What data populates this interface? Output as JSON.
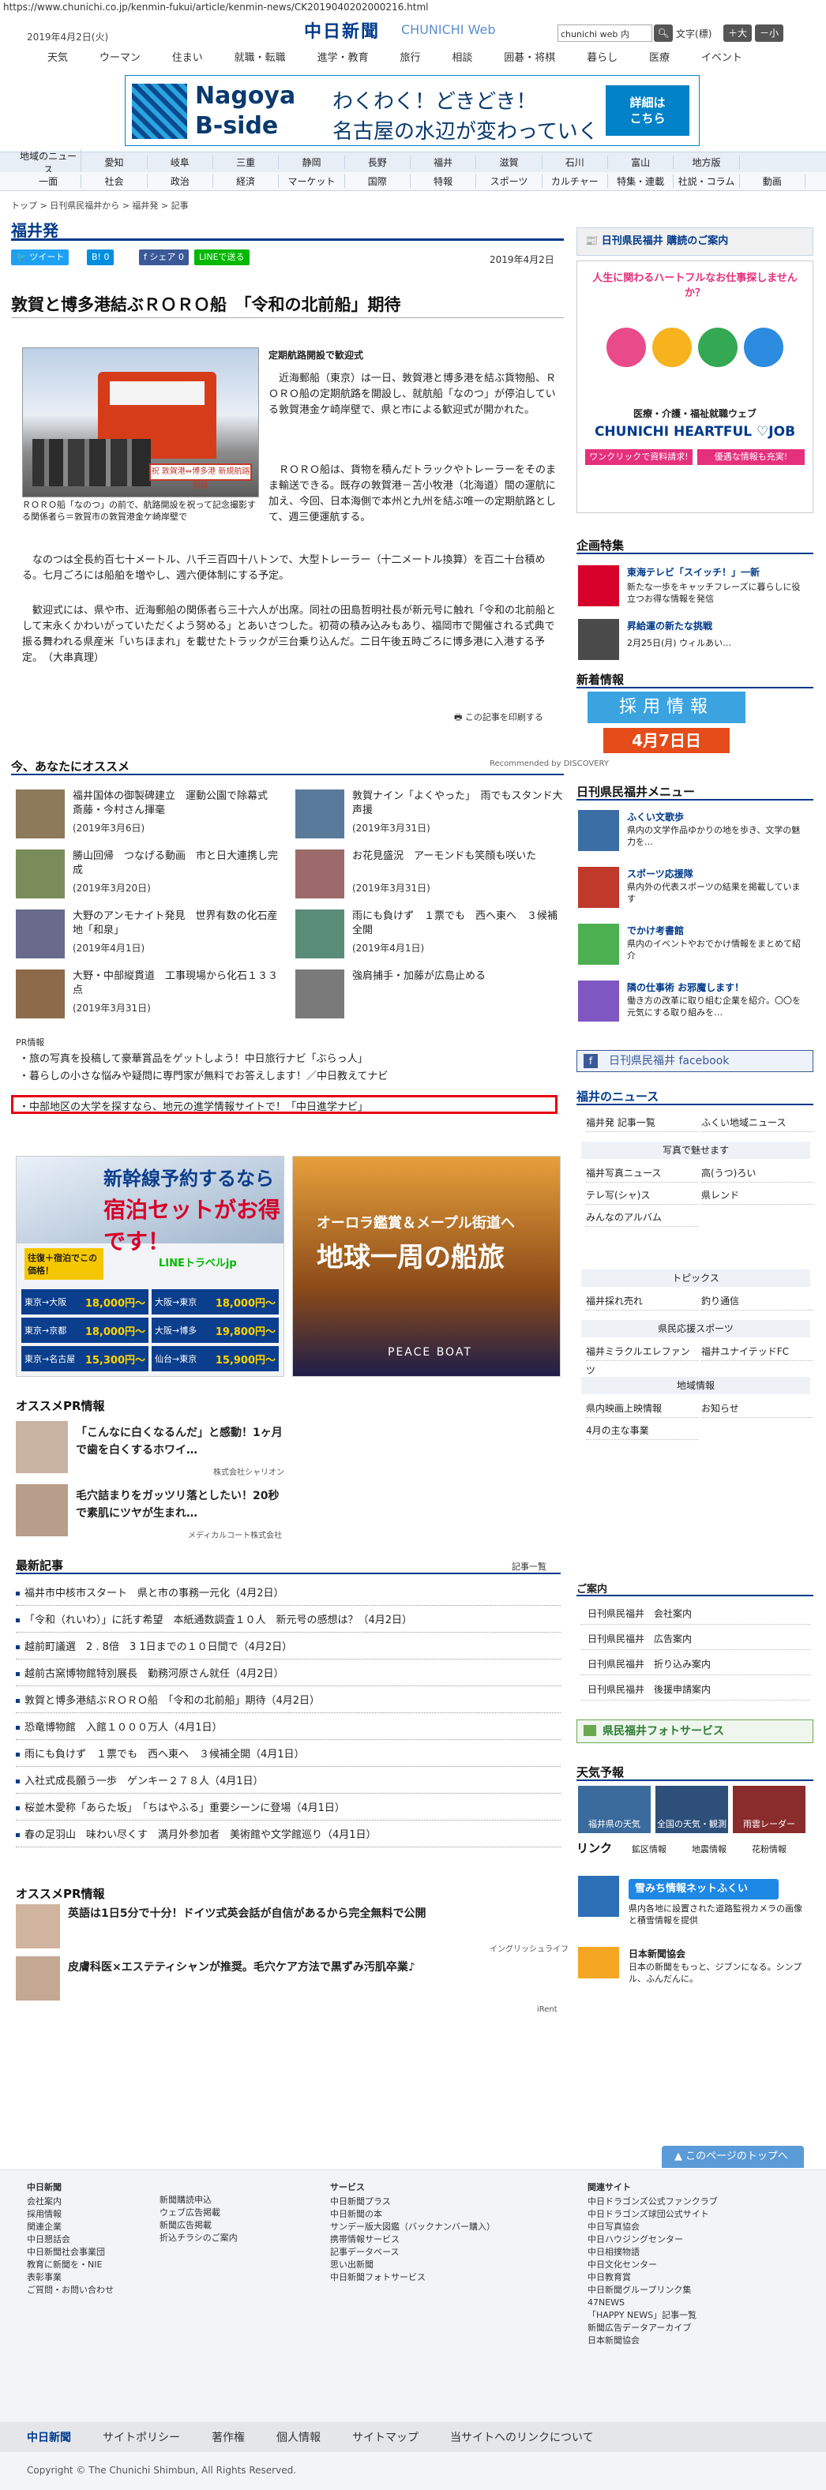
{
  "url": "https://www.chunichi.co.jp/kenmin-fukui/article/kenmin-news/CK2019040202000216.html",
  "header": {
    "date": "2019年4月2日(火)",
    "logo": "中日新聞",
    "logo_web": "CHUNICHI Web",
    "search_value": "chunichi web 内",
    "font_label": "文字",
    "font_std": "(標)",
    "font_large": "＋大",
    "font_small": "－小",
    "nav": [
      "天気",
      "ウーマン",
      "住まい",
      "就職・転職",
      "進学・教育",
      "旅行",
      "相談",
      "囲碁・将棋",
      "暮らし",
      "医療",
      "イベント"
    ]
  },
  "banner": {
    "line1": "Nagoya",
    "line2": "B-side",
    "line3": "わくわく！どきどき！",
    "line4": "名古屋の水辺が変わっていく",
    "cta": "詳細は\nこちら"
  },
  "nav1": [
    "地域のニュース",
    "愛知",
    "岐阜",
    "三重",
    "静岡",
    "長野",
    "福井",
    "滋賀",
    "石川",
    "富山",
    "地方版",
    ""
  ],
  "nav2": [
    "一面",
    "社会",
    "政治",
    "経済",
    "マーケット",
    "国際",
    "特報",
    "スポーツ",
    "カルチャー",
    "特集・連載",
    "社説・コラム",
    "動画"
  ],
  "breadcrumb": "トップ > 日刊県民福井から > 福井発 > 記事",
  "section_title": "福井発",
  "share": {
    "tweet": "ツイート",
    "b": "B! 0",
    "fb": "シェア 0",
    "line": "LINEで送る"
  },
  "article": {
    "date": "2019年4月2日",
    "headline": "敦賀と博多港結ぶＲＯＲＯ船　「令和の北前船」期待",
    "subhead": "定期航路開設で歓迎式",
    "photo_sign": "祝 敦賀港⇔博多港 新規航路開設",
    "caption": "ＲＯＲＯ船「なのつ」の前で、航路開設を祝って記念撮影する関係者ら＝敦賀市の敦賀港金ケ崎岸壁で",
    "p1": "近海郵船（東京）は一日、敦賀港と博多港を結ぶ貨物船、ＲＯＲＯ船の定期航路を開設し、就航船「なのつ」が停泊している敦賀港金ケ崎岸壁で、県と市による歓迎式が開かれた。",
    "p2": "ＲＯＲＯ船は、貨物を積んだトラックやトレーラーをそのまま輸送できる。既存の敦賀港－苫小牧港（北海道）間の運航に加え、今回、日本海側で本州と九州を結ぶ唯一の定期航路として、週三便運航する。",
    "p3": "なのつは全長約百七十メートル、八千三百四十八トンで、大型トレーラー（十二メートル換算）を百二十台積める。七月ごろには船舶を増やし、週六便体制にする予定。",
    "p4": "歓迎式には、県や市、近海郵船の関係者ら三十六人が出席。同社の田島哲明社長が新元号に触れ「令和の北前船として末永くかわいがっていただくよう努める」とあいさつした。初荷の積み込みもあり、福岡市で開催される式典で振る舞われる県産米「いちほまれ」を載せたトラックが三台乗り込んだ。二日午後五時ごろに博多港に入港する予定。　（大串真理）",
    "print": "この記事を印刷する"
  },
  "osusume": {
    "title": "今、あなたにオススメ",
    "powered": "Recommended by DISCOVERY",
    "items": [
      {
        "title": "福井国体の御製碑建立　運動公園で除幕式　斎藤・今村さん揮毫",
        "date": "(2019年3月6日)"
      },
      {
        "title": "敦賀ナイン「よくやった」　雨でもスタンド大声援",
        "date": "(2019年3月31日)"
      },
      {
        "title": "勝山回帰　つなげる動画　市と日大連携し完成",
        "date": "(2019年3月20日)"
      },
      {
        "title": "お花見盛況　アーモンドも笑顔も咲いた",
        "date": "(2019年3月31日)"
      },
      {
        "title": "大野のアンモナイト発見　世界有数の化石産地「和泉」",
        "date": "(2019年4月1日)"
      },
      {
        "title": "雨にも負けず　１票でも　西へ東へ　３候補全開",
        "date": "(2019年4月1日)"
      },
      {
        "title": "大野・中部縦貫道　工事現場から化石１３３点",
        "date": "(2019年3月31日)"
      },
      {
        "title": "強肩捕手・加藤が広島止める",
        "date": ""
      }
    ]
  },
  "pr": {
    "label": "PR情報",
    "links": [
      "旅の写真を投稿して豪華賞品をゲットしよう！中日旅行ナビ「ぶらっ人」",
      "暮らしの小さな悩みや疑問に専門家が無料でお答えします！／中日教えてナビ",
      "中部地区の大学を探すなら、地元の進学情報サイトで！「中日進学ナビ」"
    ]
  },
  "ad1": {
    "t1": "新幹線予約するなら",
    "t2": "宿泊セットがお得です！",
    "t3": "往復＋宿泊でこの価格！",
    "brand": "LINEトラベルjp",
    "prices": [
      {
        "route": "東京→大阪",
        "price": "18,000円～"
      },
      {
        "route": "大阪→東京",
        "price": "18,000円～"
      },
      {
        "route": "東京→京都",
        "price": "18,000円～"
      },
      {
        "route": "大阪→博多",
        "price": "19,800円～"
      },
      {
        "route": "東京→名古屋",
        "price": "15,300円～"
      },
      {
        "route": "仙台→東京",
        "price": "15,900円～"
      }
    ]
  },
  "ad2": {
    "t1": "オーロラ鑑賞＆メープル街道へ",
    "t2": "地球一周の船旅",
    "t3": "PEACE BOAT"
  },
  "pr2": {
    "title": "オススメPR情報",
    "items": [
      {
        "title": "「こんなに白くなるんだ」と感動！1ヶ月で歯を白くするホワイ…",
        "sponsor": "株式会社シャリオン"
      },
      {
        "title": "毛穴詰まりをガッツリ落としたい！20秒で素肌にツヤが生まれ…",
        "sponsor": "メディカルコート株式会社"
      }
    ]
  },
  "latest": {
    "title": "最新記事",
    "more": "記事一覧",
    "items": [
      "福井市中核市スタート　県と市の事務一元化（4月2日）",
      "「令和（れいわ）」に託す希望　本紙通数調査１０人　新元号の感想は？（4月2日）",
      "越前町議選　2 . 8倍　3 1日までの１０日間で（4月2日）",
      "越前古窯博物館特別展長　勤務河原さん就任（4月2日）",
      "敦賀と博多港結ぶＲＯＲＯ船　「令和の北前船」期待（4月2日）",
      "恐竜博物館　入館１０００万人（4月1日）",
      "雨にも負けず　１票でも　西へ東へ　３候補全開（4月1日）",
      "入社式成長願う一歩　ゲンキー２７８人（4月1日）",
      "桜並木愛称「あらた坂」　「ちはやふる」重要シーンに登場（4月1日）",
      "春の足羽山　味わい尽くす　満月外参加者　美術館や文学館巡り（4月1日）"
    ]
  },
  "pr3": {
    "title": "オススメPR情報",
    "items": [
      {
        "title": "英語は1日5分で十分！ドイツ式英会話が自信があるから完全無料で公開",
        "sponsor": "イングリッシュライフ"
      },
      {
        "title": "皮膚科医×エステティシャンが推奨。毛穴ケア方法で黒ずみ汚肌卒業♪",
        "sponsor": ""
      }
    ],
    "footer_label": "iRent"
  },
  "sidebar": {
    "subscribe": "日刊県民福井 購読のご案内",
    "ad_text1": "人生に関わるハートフルなお仕事探しませんか？",
    "ad_brand": "CHUNICHI HEARTFUL ♡JOB",
    "ad_sub": "医療・介護・福祉就職ウェブ",
    "ad_cta": "ワンクリックで資料請求!",
    "ad_cta2": "優遇な情報も充実!",
    "kikaku_title": "企画特集",
    "kikaku": [
      {
        "title": "東海テレビ「スイッチ！」一新",
        "desc": "新たな一歩をキャッチフレーズに暮らしに役立つお得な情報を発信"
      },
      {
        "title": "昇給運の新たな挑戦",
        "desc": "2月25日(月) ウィルあい…"
      }
    ],
    "shinchaku_title": "新着情報",
    "recruit_label": "採用情報",
    "recruit_date": "4月7日日",
    "menu_title": "日刊県民福井メニュー",
    "menu": [
      {
        "title": "ふくい文歌歩",
        "desc": "県内の文学作品ゆかりの地を歩き、文学の魅力を…"
      },
      {
        "title": "スポーツ応援隊",
        "desc": "県内外の代表スポーツの結果を掲載しています"
      },
      {
        "title": "でかけ考書館",
        "desc": "県内のイベントやおでかけ情報をまとめて紹介"
      },
      {
        "title": "隣の仕事術 お邪魔します！",
        "desc": "働き方の改革に取り組む企業を紹介。〇〇を元気にする取り組みを…"
      }
    ],
    "facebook": "日刊県民福井 facebook",
    "fukui_news_title": "福井のニュース",
    "fukui_news": [
      "福井発 記事一覧",
      "ふくい地域ニュース"
    ],
    "photo_title": "写真で魅せます",
    "photo_items": [
      "福井写真ニュース",
      "高(うつ)ろい",
      "テレ写(シャ)ス",
      "県レンド",
      "みんなのアルバム",
      ""
    ],
    "topics_title": "トピックス",
    "topics": [
      "福井採れ売れ",
      "釣り通信"
    ],
    "sports_title": "県民応援スポーツ",
    "sports": [
      "福井ミラクルエレファンツ",
      "福井ユナイテッドFC"
    ],
    "chiiki_title": "地域情報",
    "chiiki": [
      "県内映画上映情報",
      "お知らせ",
      "4月の主な事業"
    ],
    "annai_title": "ご案内",
    "annai": [
      "日刊県民福井　会社案内",
      "日刊県民福井　広告案内",
      "日刊県民福井　折り込み案内",
      "日刊県民福井　後援申請案内"
    ],
    "photo_service": "県民福井フォトサービス",
    "tenki_title": "天気予報",
    "tenki_items": [
      "福井県の天気",
      "全国の天気・観測",
      "雨雲レーダー"
    ],
    "link_title": "リンク",
    "link_items": [
      "鉱区情報",
      "地震情報",
      "花粉情報"
    ],
    "snow_net": "雪みち情報ネットふくい",
    "snow_desc": "県内各地に設置された道路監視カメラの画像と積雪情報を提供",
    "kyokai": "日本新聞協会",
    "kyokai_desc": "日本の新聞をもっと、ジブンになる。シンプル、ふんだんに。"
  },
  "pagetop": "このページのトップへ",
  "footer": {
    "col1_title": "中日新聞",
    "col1": [
      "会社案内",
      "採用情報",
      "関連企業",
      "中日懇話会",
      "中日新聞社会事業団",
      "教育に新聞を・NIE",
      "表彰事業",
      "ご質問・お問い合わせ"
    ],
    "col2": [
      "新聞購読申込",
      "ウェブ広告掲載",
      "新聞広告掲載",
      "折込チラシのご案内"
    ],
    "col3_title": "サービス",
    "col3": [
      "中日新聞プラス",
      "中日新聞の本",
      "サンデー版大図鑑（バックナンバー購入）",
      "携帯情報サービス",
      "記事データベース",
      "思い出新聞",
      "中日新聞フォトサービス"
    ],
    "col4_title": "関連サイト",
    "col4": [
      "中日ドラゴンズ公式ファンクラブ",
      "中日ドラゴンズ球団公式サイト",
      "中日写真協会",
      "中日ハウジングセンター",
      "中日相撲物語",
      "中日文化センター",
      "中日教育賞",
      "中日新聞グループリンク集",
      "47NEWS",
      "「HAPPY NEWS」記事一覧",
      "新聞広告データアーカイブ",
      "日本新聞協会"
    ],
    "bar": [
      "中日新聞",
      "サイトポリシー",
      "著作権",
      "個人情報",
      "サイトマップ",
      "当サイトへのリンクについて"
    ],
    "copyright": "Copyright © The Chunichi Shimbun, All Rights Reserved."
  }
}
